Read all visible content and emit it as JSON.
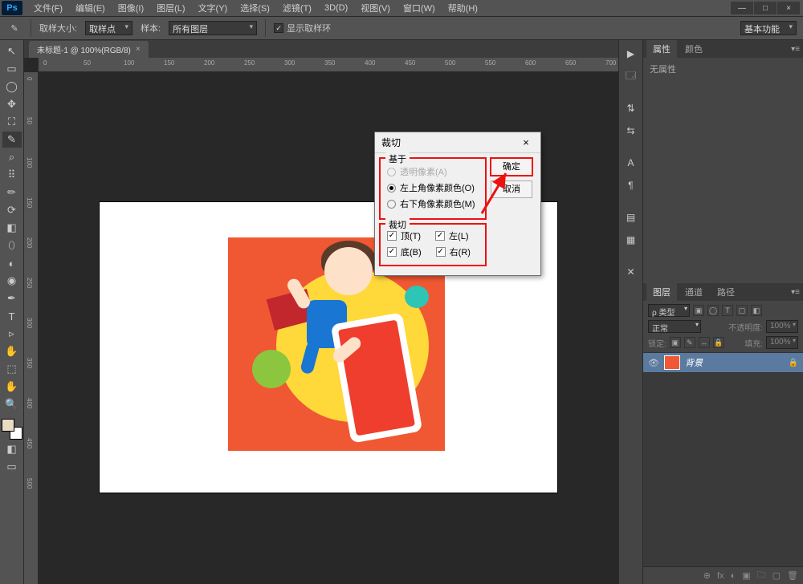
{
  "app": {
    "logo": "Ps"
  },
  "menus": [
    "文件(F)",
    "编辑(E)",
    "图像(I)",
    "图层(L)",
    "文字(Y)",
    "选择(S)",
    "滤镜(T)",
    "3D(D)",
    "视图(V)",
    "窗口(W)",
    "帮助(H)"
  ],
  "win": {
    "min": "—",
    "max": "□",
    "close": "×"
  },
  "options": {
    "sampleSizeLabel": "取样大小:",
    "sampleSizeValue": "取样点",
    "sampleLabel": "样本:",
    "sampleValue": "所有图层",
    "showRing": "显示取样环",
    "essentials": "基本功能"
  },
  "docTab": {
    "title": "未标题-1 @ 100%(RGB/8)",
    "close": "×"
  },
  "rulerH": [
    "0",
    "50",
    "100",
    "150",
    "200",
    "250",
    "300",
    "350",
    "400",
    "450",
    "500",
    "550",
    "600",
    "650",
    "700"
  ],
  "rulerV": [
    "0",
    "50",
    "100",
    "150",
    "200",
    "250",
    "300",
    "350",
    "400",
    "450",
    "500"
  ],
  "tools": [
    "↖",
    "▭",
    "◯",
    "✥",
    "⛶",
    "✎",
    "⌕",
    "⠿",
    "✏",
    "⟳",
    "◧",
    "⬯",
    "◐",
    "◉",
    "✒",
    "T",
    "▹",
    "✋",
    "⬚",
    "✋",
    "🔍"
  ],
  "stripe": [
    "▶",
    "🗔",
    "",
    "⇅",
    "⇆",
    "",
    "A",
    "¶",
    "",
    "▤",
    "▦",
    "",
    "✕"
  ],
  "propsPanel": {
    "tabs": [
      "属性",
      "颜色"
    ],
    "noProps": "无属性"
  },
  "layersPanel": {
    "tabs": [
      "图层",
      "通道",
      "路径"
    ],
    "kind": "ρ 类型",
    "filterIcons": [
      "▣",
      "◯",
      "T",
      "▢",
      "◧"
    ],
    "blend": "正常",
    "opacityLabel": "不透明度:",
    "opacity": "100%",
    "lockLabel": "锁定:",
    "lockIcons": [
      "▣",
      "✎",
      "↔",
      "🔒"
    ],
    "fillLabel": "填充:",
    "fill": "100%",
    "layer": {
      "eye": "👁",
      "name": "背景",
      "lock": "🔒"
    },
    "footer": [
      "⊕",
      "fx",
      "◐",
      "▣",
      "🗀",
      "🗑"
    ]
  },
  "dialog": {
    "title": "裁切",
    "close": "×",
    "basedOn": {
      "legend": "基于",
      "transparent": "透明像素(A)",
      "topLeft": "左上角像素颜色(O)",
      "bottomRight": "右下角像素颜色(M)"
    },
    "trim": {
      "legend": "裁切",
      "top": "顶(T)",
      "left": "左(L)",
      "bottom": "底(B)",
      "right": "右(R)"
    },
    "ok": "确定",
    "cancel": "取消"
  }
}
